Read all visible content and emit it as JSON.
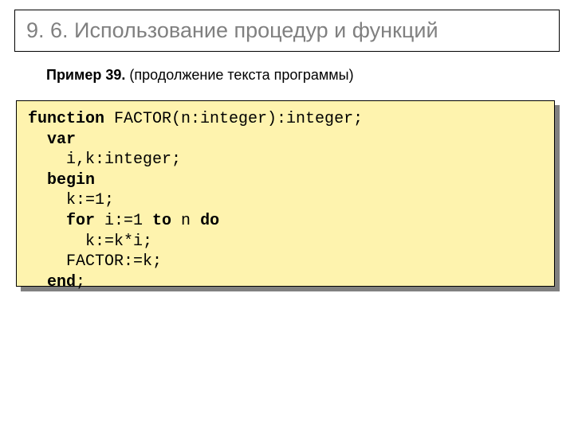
{
  "title": "9. 6. Использование процедур и функций",
  "example": {
    "label": "Пример 39.",
    "desc": "  (продолжение текста программы)"
  },
  "code": {
    "l1a": "function",
    "l1b": " FACTOR(n:integer):integer;",
    "l2a": "  var",
    "l3": "    i,k:integer;",
    "l4a": "  begin",
    "l5": "    k:=1;",
    "l6a": "    for",
    "l6b": " i:=1 ",
    "l6c": "to",
    "l6d": " n ",
    "l6e": "do",
    "l7": "      k:=k*i;",
    "l8": "    FACTOR:=k;",
    "l9a": "  end",
    "l9b": ";"
  }
}
